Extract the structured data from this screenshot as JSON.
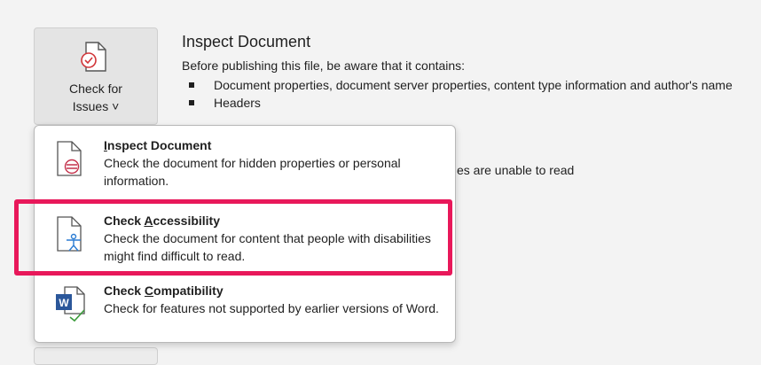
{
  "check_button": {
    "line1": "Check for",
    "line2": "Issues ˅"
  },
  "inspect_panel": {
    "title": "Inspect Document",
    "intro": "Before publishing this file, be aware that it contains:",
    "bullets": [
      "Document properties, document server properties, content type information and author's name",
      "Headers"
    ],
    "partial_text": "es are unable to read"
  },
  "menu": {
    "items": [
      {
        "title_pre": "",
        "title_key": "I",
        "title_post": "nspect Document",
        "desc": "Check the document for hidden properties or personal information."
      },
      {
        "title_pre": "Check ",
        "title_key": "A",
        "title_post": "ccessibility",
        "desc": "Check the document for content that people with disabilities might find difficult to read."
      },
      {
        "title_pre": "Check ",
        "title_key": "C",
        "title_post": "ompatibility",
        "desc": "Check for features not supported by earlier versions of Word."
      }
    ]
  },
  "colors": {
    "highlight": "#e8185a",
    "accessibility_icon": "#2b7cd3",
    "word_icon": "#2b579a",
    "check_green": "#3a9b3a"
  }
}
